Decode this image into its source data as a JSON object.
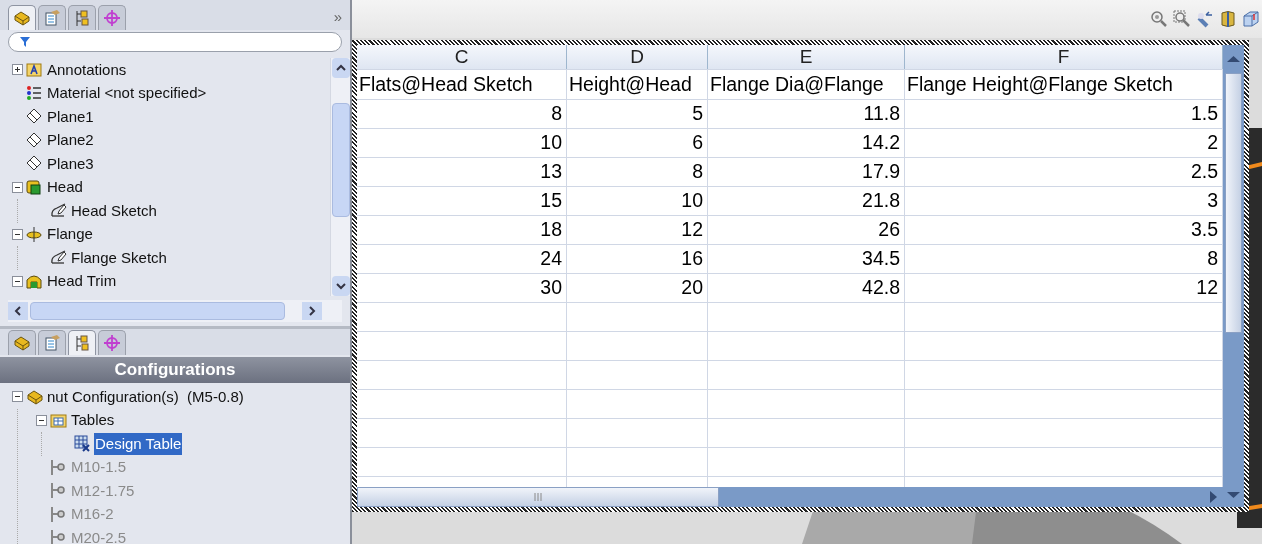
{
  "feature_panel": {
    "tabs": [
      {
        "kind": "part",
        "selected": true
      },
      {
        "kind": "property",
        "selected": false
      },
      {
        "kind": "config",
        "selected": false
      },
      {
        "kind": "display",
        "selected": false
      }
    ],
    "expand_glyph": "»",
    "tree": [
      {
        "label": "Annotations",
        "kind": "annotations",
        "expanded": false
      },
      {
        "label": "Material <not specified>",
        "kind": "material"
      },
      {
        "label": "Plane1",
        "kind": "plane"
      },
      {
        "label": "Plane2",
        "kind": "plane"
      },
      {
        "label": "Plane3",
        "kind": "plane"
      },
      {
        "label": "Head",
        "kind": "extrude",
        "expanded": true,
        "children": [
          {
            "label": "Head Sketch",
            "kind": "sketch"
          }
        ]
      },
      {
        "label": "Flange",
        "kind": "revolve",
        "expanded": true,
        "children": [
          {
            "label": "Flange Sketch",
            "kind": "sketch"
          }
        ]
      },
      {
        "label": "Head Trim",
        "kind": "cut",
        "expanded": true
      }
    ]
  },
  "config_panel": {
    "tabs": [
      {
        "kind": "part",
        "selected": false
      },
      {
        "kind": "property",
        "selected": false
      },
      {
        "kind": "config",
        "selected": true
      },
      {
        "kind": "display",
        "selected": false
      }
    ],
    "title": "Configurations",
    "tree": [
      {
        "label": "nut Configuration(s)  (M5-0.8)",
        "kind": "root",
        "expanded": true,
        "selected": false,
        "children": [
          {
            "label": "Tables",
            "kind": "tables",
            "expanded": true,
            "selected": false,
            "children": [
              {
                "label": "Design Table",
                "kind": "design_table",
                "selected": true
              }
            ]
          },
          {
            "label": "M10-1.5",
            "kind": "config",
            "selected": false
          },
          {
            "label": "M12-1.75",
            "kind": "config",
            "selected": false
          },
          {
            "label": "M16-2",
            "kind": "config",
            "selected": false
          },
          {
            "label": "M20-2.5",
            "kind": "config",
            "selected": false
          }
        ]
      }
    ]
  },
  "design_table": {
    "columns": [
      {
        "letter": "C",
        "header": "Flats@Head Sketch"
      },
      {
        "letter": "D",
        "header": "Height@Head"
      },
      {
        "letter": "E",
        "header": "Flange Dia@Flange"
      },
      {
        "letter": "F",
        "header": "Flange Height@Flange Sketch"
      }
    ],
    "rows": [
      [
        "8",
        "5",
        "11.8",
        "1.5"
      ],
      [
        "10",
        "6",
        "14.2",
        "2"
      ],
      [
        "13",
        "8",
        "17.9",
        "2.5"
      ],
      [
        "15",
        "10",
        "21.8",
        "3"
      ],
      [
        "18",
        "12",
        "26",
        "3.5"
      ],
      [
        "24",
        "16",
        "34.5",
        "8"
      ],
      [
        "30",
        "20",
        "42.8",
        "12"
      ]
    ]
  }
}
